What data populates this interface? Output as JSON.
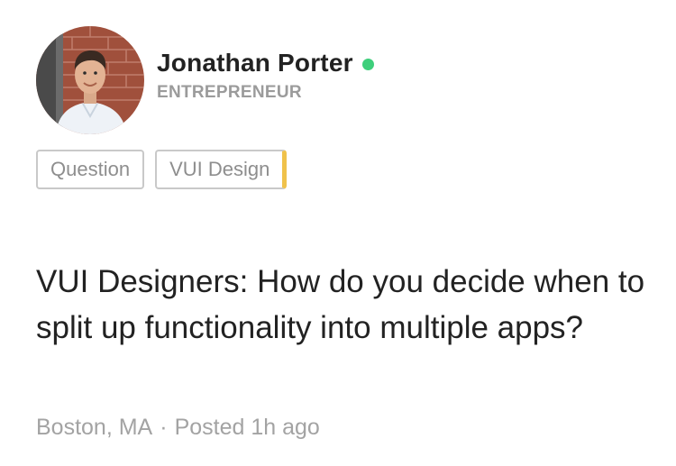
{
  "author": {
    "name": "Jonathan Porter",
    "role": "ENTREPRENEUR",
    "online_status": "online",
    "online_color": "#3ecf7b"
  },
  "tags": [
    {
      "label": "Question"
    },
    {
      "label": "VUI Design"
    }
  ],
  "tag_accent_color": "#f0c24b",
  "question": {
    "title": "VUI Designers: How do you decide when to split up functionality into multiple apps?"
  },
  "meta": {
    "location": "Boston, MA",
    "separator": "·",
    "posted": "Posted 1h ago"
  },
  "icons": {
    "avatar": "avatar-photo",
    "online": "online-status-dot"
  }
}
